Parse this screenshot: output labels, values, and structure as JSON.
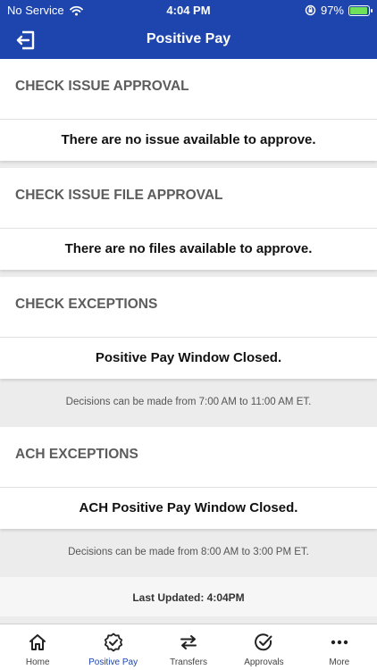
{
  "status_bar": {
    "carrier": "No Service",
    "time": "4:04 PM",
    "battery": "97%",
    "battery_level": 0.97
  },
  "header": {
    "title": "Positive Pay",
    "back_icon": "logout-icon"
  },
  "sections": [
    {
      "title": "CHECK ISSUE APPROVAL",
      "message": "There are no issue available to approve."
    },
    {
      "title": "CHECK ISSUE FILE APPROVAL",
      "message": "There are no files available to approve."
    },
    {
      "title": "CHECK EXCEPTIONS",
      "message": "Positive Pay Window Closed.",
      "note": "Decisions can be made from 7:00 AM to 11:00 AM ET."
    },
    {
      "title": "ACH EXCEPTIONS",
      "message": "ACH Positive Pay Window Closed.",
      "note": "Decisions can be made from 8:00 AM to 3:00 PM ET."
    }
  ],
  "last_updated": "Last Updated: 4:04PM",
  "tabs": [
    {
      "label": "Home",
      "icon": "home-icon"
    },
    {
      "label": "Positive Pay",
      "icon": "badge-check-icon",
      "active": true
    },
    {
      "label": "Transfers",
      "icon": "transfer-arrows-icon"
    },
    {
      "label": "Approvals",
      "icon": "check-circle-icon"
    },
    {
      "label": "More",
      "icon": "more-dots-icon"
    }
  ],
  "colors": {
    "brand": "#1e45ad",
    "background": "#ececec",
    "battery": "#6fe05a"
  }
}
